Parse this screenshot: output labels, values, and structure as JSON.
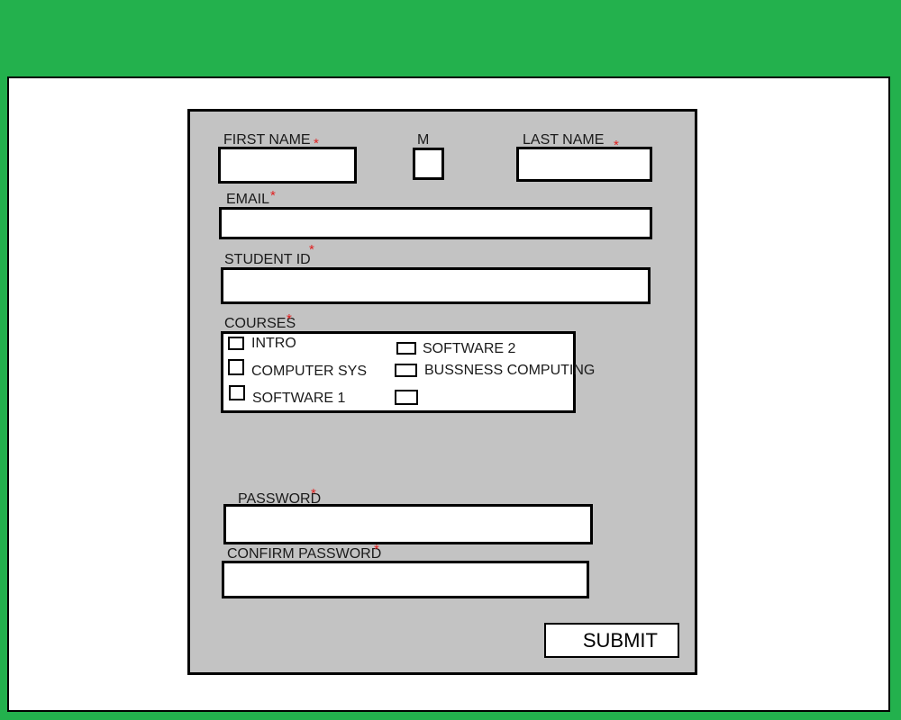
{
  "colors": {
    "background": "#23b14d",
    "panel": "#c3c3c3",
    "required_star": "#e02020"
  },
  "form": {
    "first_name_label": "FIRST NAME",
    "middle_initial_label": "M",
    "last_name_label": "LAST NAME",
    "email_label": "EMAIL",
    "student_id_label": "STUDENT ID",
    "courses_label": "COURSES",
    "password_label": "PASSWORD",
    "confirm_password_label": "CONFIRM PASSWORD",
    "required_mark": "*",
    "courses": [
      {
        "label": "INTRO"
      },
      {
        "label": "COMPUTER SYS"
      },
      {
        "label": "SOFTWARE 1"
      },
      {
        "label": "SOFTWARE 2"
      },
      {
        "label": "BUSSNESS COMPUTING"
      },
      {
        "label": ""
      }
    ],
    "submit_label": "SUBMIT"
  }
}
